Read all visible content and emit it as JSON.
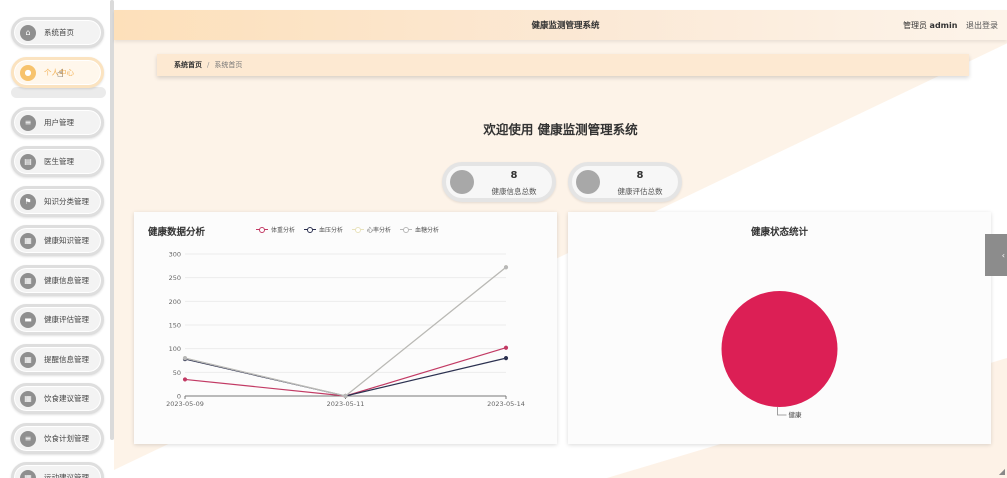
{
  "sidebar": {
    "items": [
      {
        "label": "系统首页",
        "icon": "home-icon",
        "glyph": "⌂"
      },
      {
        "label": "个人中心",
        "icon": "user-icon",
        "glyph": "●"
      },
      {
        "label": "用户管理",
        "icon": "list-icon",
        "glyph": "≡"
      },
      {
        "label": "医生管理",
        "icon": "doctor-icon",
        "glyph": "▤"
      },
      {
        "label": "知识分类管理",
        "icon": "flag-icon",
        "glyph": "⚑"
      },
      {
        "label": "健康知识管理",
        "icon": "grid-icon",
        "glyph": "▦"
      },
      {
        "label": "健康信息管理",
        "icon": "grid-icon",
        "glyph": "▦"
      },
      {
        "label": "健康评估管理",
        "icon": "form-icon",
        "glyph": "▬"
      },
      {
        "label": "提醒信息管理",
        "icon": "grid-icon",
        "glyph": "▦"
      },
      {
        "label": "饮食建议管理",
        "icon": "grid-icon",
        "glyph": "▦"
      },
      {
        "label": "饮食计划管理",
        "icon": "list-icon",
        "glyph": "≡"
      },
      {
        "label": "运动建议管理",
        "icon": "grid-icon",
        "glyph": "▦"
      }
    ]
  },
  "header": {
    "title": "健康监测管理系统",
    "user_role": "管理员",
    "user_name": "admin",
    "logout": "退出登录"
  },
  "breadcrumb": {
    "home": "系统首页",
    "separator": "/",
    "current": "系统首页"
  },
  "welcome": "欢迎使用 健康监测管理系统",
  "stats": [
    {
      "value": "8",
      "label": "健康信息总数"
    },
    {
      "value": "8",
      "label": "健康评估总数"
    }
  ],
  "colors": {
    "accent": "#f7c36d",
    "header_start": "#fde0ba",
    "pie": "#dc1f55"
  },
  "chart_data": [
    {
      "type": "line",
      "title": "健康数据分析",
      "x": [
        "2023-05-09",
        "2023-05-11",
        "2023-05-14"
      ],
      "ylim": [
        0,
        300
      ],
      "yticks": [
        0,
        50,
        100,
        150,
        200,
        250,
        300
      ],
      "series": [
        {
          "name": "体重分析",
          "color": "#c23a64",
          "values": [
            35,
            0,
            102
          ]
        },
        {
          "name": "血压分析",
          "color": "#2c3150",
          "values": [
            78,
            0,
            80
          ]
        },
        {
          "name": "心率分析",
          "color": "#e8e2bc",
          "values": [
            80,
            0,
            272
          ]
        },
        {
          "name": "血糖分析",
          "color": "#b8b8b8",
          "values": [
            80,
            0,
            272
          ]
        }
      ],
      "legend": "top"
    },
    {
      "type": "pie",
      "title": "健康状态统计",
      "slices": [
        {
          "label": "健康",
          "value": 8,
          "color": "#dc1f55"
        }
      ]
    }
  ]
}
